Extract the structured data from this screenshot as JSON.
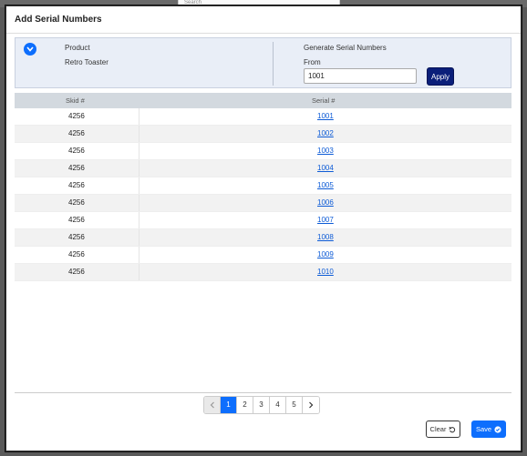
{
  "background": {
    "field_text": "Search"
  },
  "modal": {
    "title": "Add Serial Numbers"
  },
  "product_panel": {
    "product_label": "Product",
    "product_value": "Retro Toaster",
    "generate_label": "Generate Serial Numbers",
    "from_label": "From",
    "from_value": "1001",
    "apply_label": "Apply"
  },
  "table": {
    "headers": {
      "skid": "Skid #",
      "serial": "Serial #"
    },
    "rows": [
      {
        "skid": "4256",
        "serial": "1001"
      },
      {
        "skid": "4256",
        "serial": "1002"
      },
      {
        "skid": "4256",
        "serial": "1003"
      },
      {
        "skid": "4256",
        "serial": "1004"
      },
      {
        "skid": "4256",
        "serial": "1005"
      },
      {
        "skid": "4256",
        "serial": "1006"
      },
      {
        "skid": "4256",
        "serial": "1007"
      },
      {
        "skid": "4256",
        "serial": "1008"
      },
      {
        "skid": "4256",
        "serial": "1009"
      },
      {
        "skid": "4256",
        "serial": "1010"
      }
    ]
  },
  "pagination": {
    "pages": [
      "1",
      "2",
      "3",
      "4",
      "5"
    ],
    "current": "1"
  },
  "footer": {
    "clear_label": "Clear",
    "save_label": "Save"
  },
  "colors": {
    "primary": "#0d6efd",
    "apply": "#0b1f7a",
    "panel": "#e9eef7",
    "table_header": "#d3d9df",
    "link": "#0d5bd6"
  },
  "icons": {
    "toggle": "chevron-down-icon",
    "prev": "chevron-left-icon",
    "next": "chevron-right-icon",
    "clear": "undo-icon",
    "save": "check-circle-icon"
  }
}
